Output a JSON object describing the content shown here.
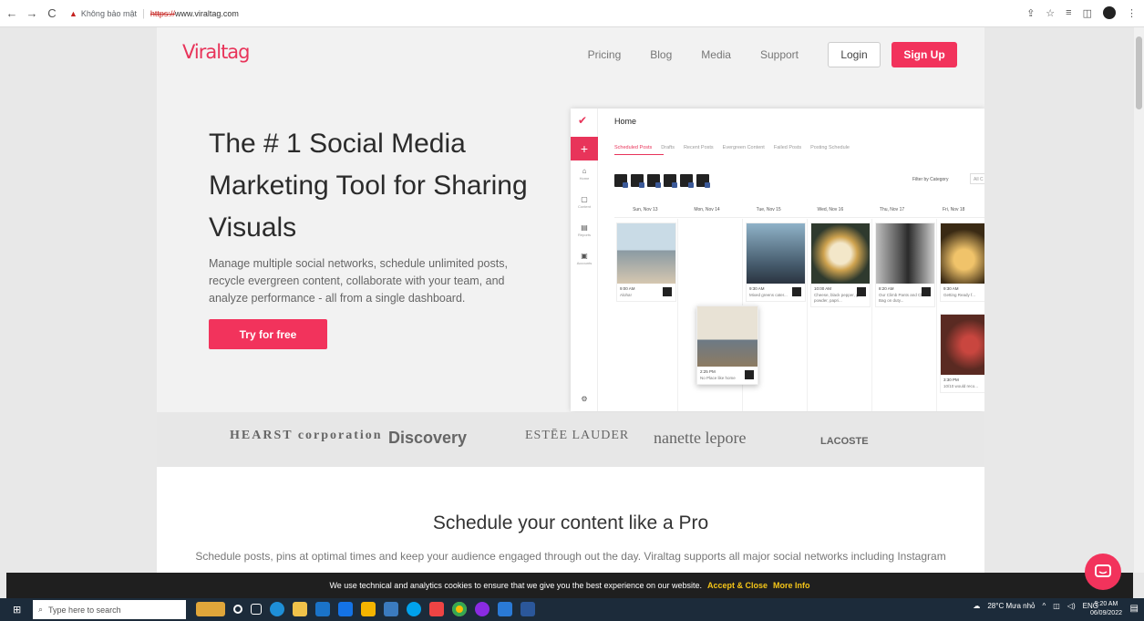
{
  "browser": {
    "back": "←",
    "forward": "→",
    "reload": "C",
    "warn_icon": "▲",
    "security_text": "Không bảo mật",
    "url_scheme": "https://",
    "url_host": "www.viraltag.com"
  },
  "site": {
    "logo": "Viraltag",
    "nav": [
      "Pricing",
      "Blog",
      "Media",
      "Support"
    ],
    "login": "Login",
    "signup": "Sign Up",
    "hero_title": "The # 1 Social Media Marketing Tool for Sharing Visuals",
    "hero_sub": "Manage multiple social networks, schedule unlimited posts, recycle evergreen content, collaborate with your team, and analyze performance - all from a single dashboard.",
    "cta": "Try for free",
    "brands": [
      "HEARST corporation",
      "Discovery",
      "ESTĒE LAUDER",
      "nanette lepore",
      "LACOSTE"
    ],
    "section_title": "Schedule your content like a Pro",
    "section_sub": "Schedule posts, pins at optimal times and keep your audience engaged through out the day. Viraltag supports all major social networks including Instagram"
  },
  "mockup": {
    "title": "Home",
    "tabs": [
      "Scheduled Posts",
      "Drafts",
      "Recent Posts",
      "Evergreen Content",
      "Failed Posts",
      "Posting Schedule"
    ],
    "sidebar": [
      "Home",
      "Content",
      "Reports",
      "Accounts"
    ],
    "filter_label": "Filter by Category",
    "filter_value": "All C",
    "days": [
      "Sun, Nov 13",
      "Mon, Nov 14",
      "Tue, Nov 15",
      "Wed, Nov 16",
      "Thu, Nov 17",
      "Fri, Nov 18"
    ],
    "cards": [
      {
        "time": "9:00 AM",
        "text": "Aloha!"
      },
      {
        "time": "9:30 AM",
        "text": "Mixed greens cater..."
      },
      {
        "time": "10:00 AM",
        "text": "Cheese, black pepper, garlic powder, papri..."
      },
      {
        "time": "8:20 AM",
        "text": "Our Climb Pants and Chalk Bag on duty..."
      },
      {
        "time": "9:30 AM",
        "text": "Getting Ready f..."
      }
    ],
    "dragged_card": {
      "time": "2:25 PM",
      "text": "No Place like home"
    },
    "extra_card": {
      "time": "3:30 PM",
      "text": "10/10 would reco..."
    }
  },
  "cookie": {
    "text": "We use technical and analytics cookies to ensure that we give you the best experience on our website.",
    "accept": "Accept & Close",
    "more": "More Info"
  },
  "taskbar": {
    "search_placeholder": "Type here to search",
    "weather": "28°C  Mưa nhỏ",
    "lang": "ENG",
    "time": "9:20 AM",
    "date": "06/09/2022"
  }
}
